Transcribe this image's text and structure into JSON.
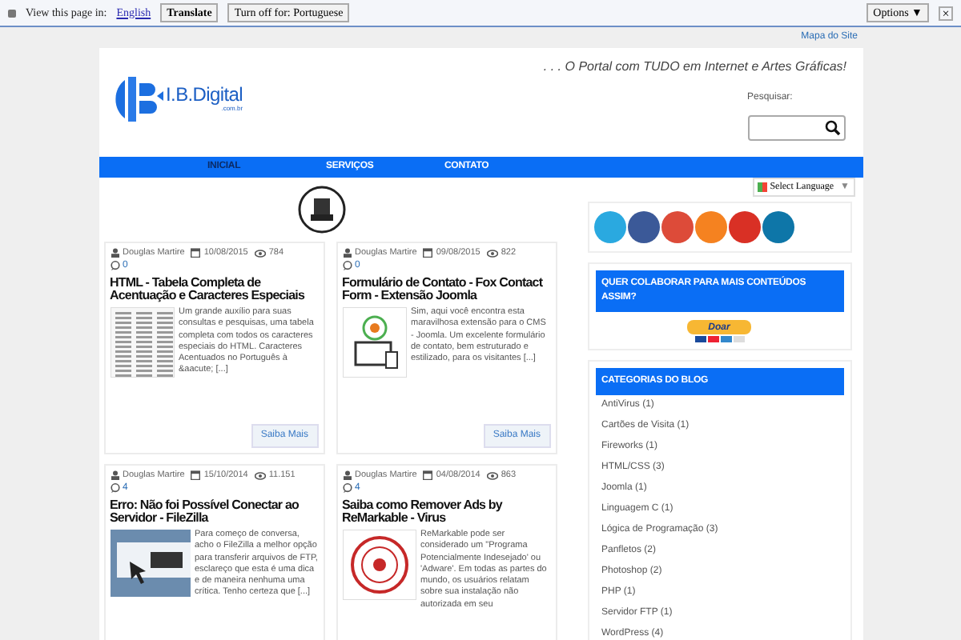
{
  "translate_bar": {
    "prompt": "View this page in:",
    "language": "English",
    "translate_button": "Translate",
    "turn_off_button": "Turn off for: Portuguese",
    "options_button": "Options ▼",
    "close": "×"
  },
  "top_link": "Mapa do Site",
  "header": {
    "logo_text": "I.B.Digital",
    "logo_sub": ".com.br",
    "tagline": ". . . O Portal com TUDO em Internet e Artes Gráficas!",
    "search_label": "Pesquisar:"
  },
  "nav": [
    {
      "label": "INICIAL",
      "selected": true
    },
    {
      "label": "SERVIÇOS",
      "selected": false
    },
    {
      "label": "CONTATO",
      "selected": false
    }
  ],
  "language_select": "Select Language",
  "language_caret": "▼",
  "posts": [
    {
      "author": "Douglas Martire",
      "date": "10/08/2015",
      "views": "784",
      "comments": "0",
      "title": "HTML - Tabela Completa de Acentuação e Caracteres Especiais",
      "kind": "table",
      "excerpt": "Um grande auxílio para suas consultas e pesquisas, uma tabela completa com todos os caracteres especiais do HTML. Caracteres Acentuados no Português à &aacute; [...]",
      "more": "Saiba Mais"
    },
    {
      "author": "Douglas Martire",
      "date": "09/08/2015",
      "views": "822",
      "comments": "0",
      "title": "Formulário de Contato - Fox Contact Form - Extensão Joomla",
      "kind": "devices",
      "excerpt": "Sim, aqui você encontra esta maravilhosa extensão para o CMS - Joomla. Um excelente formulário de contato, bem estruturado e estilizado, para os visitantes [...]",
      "more": "Saiba Mais"
    },
    {
      "author": "Douglas Martire",
      "date": "15/10/2014",
      "views": "11.151",
      "comments": "4",
      "title": "Erro: Não foi Possível Conectar ao Servidor - FileZilla",
      "kind": "ftp",
      "excerpt": "Para começo de conversa, acho o FileZilla a melhor opção para transferir arquivos de FTP, esclareço que esta é uma dica e de maneira nenhuma uma crítica. Tenho certeza que [...]"
    },
    {
      "author": "Douglas Martire",
      "date": "04/08/2014",
      "views": "863",
      "comments": "4",
      "title": "Saiba como Remover Ads by ReMarkable - Virus",
      "kind": "stamp",
      "excerpt": "ReMarkable pode ser considerado um \"Programa Potencialmente Indesejado' ou 'Adware'. Em todas as partes do mundo, os usuários relatam sobre sua instalação não autorizada em seu"
    }
  ],
  "sidebar": {
    "donate_title": "QUER COLABORAR PARA MAIS CONTEÚDOS ASSIM?",
    "donate_button": "Doar",
    "categories_title": "CATEGORIAS DO BLOG",
    "categories": [
      "AntiVirus (1)",
      "Cartões de Visita (1)",
      "Fireworks (1)",
      "HTML/CSS (3)",
      "Joomla (1)",
      "Linguagem C (1)",
      "Lógica de Programação (3)",
      "Panfletos (2)",
      "Photoshop (2)",
      "PHP (1)",
      "Servidor FTP (1)",
      "WordPress (4)"
    ]
  }
}
